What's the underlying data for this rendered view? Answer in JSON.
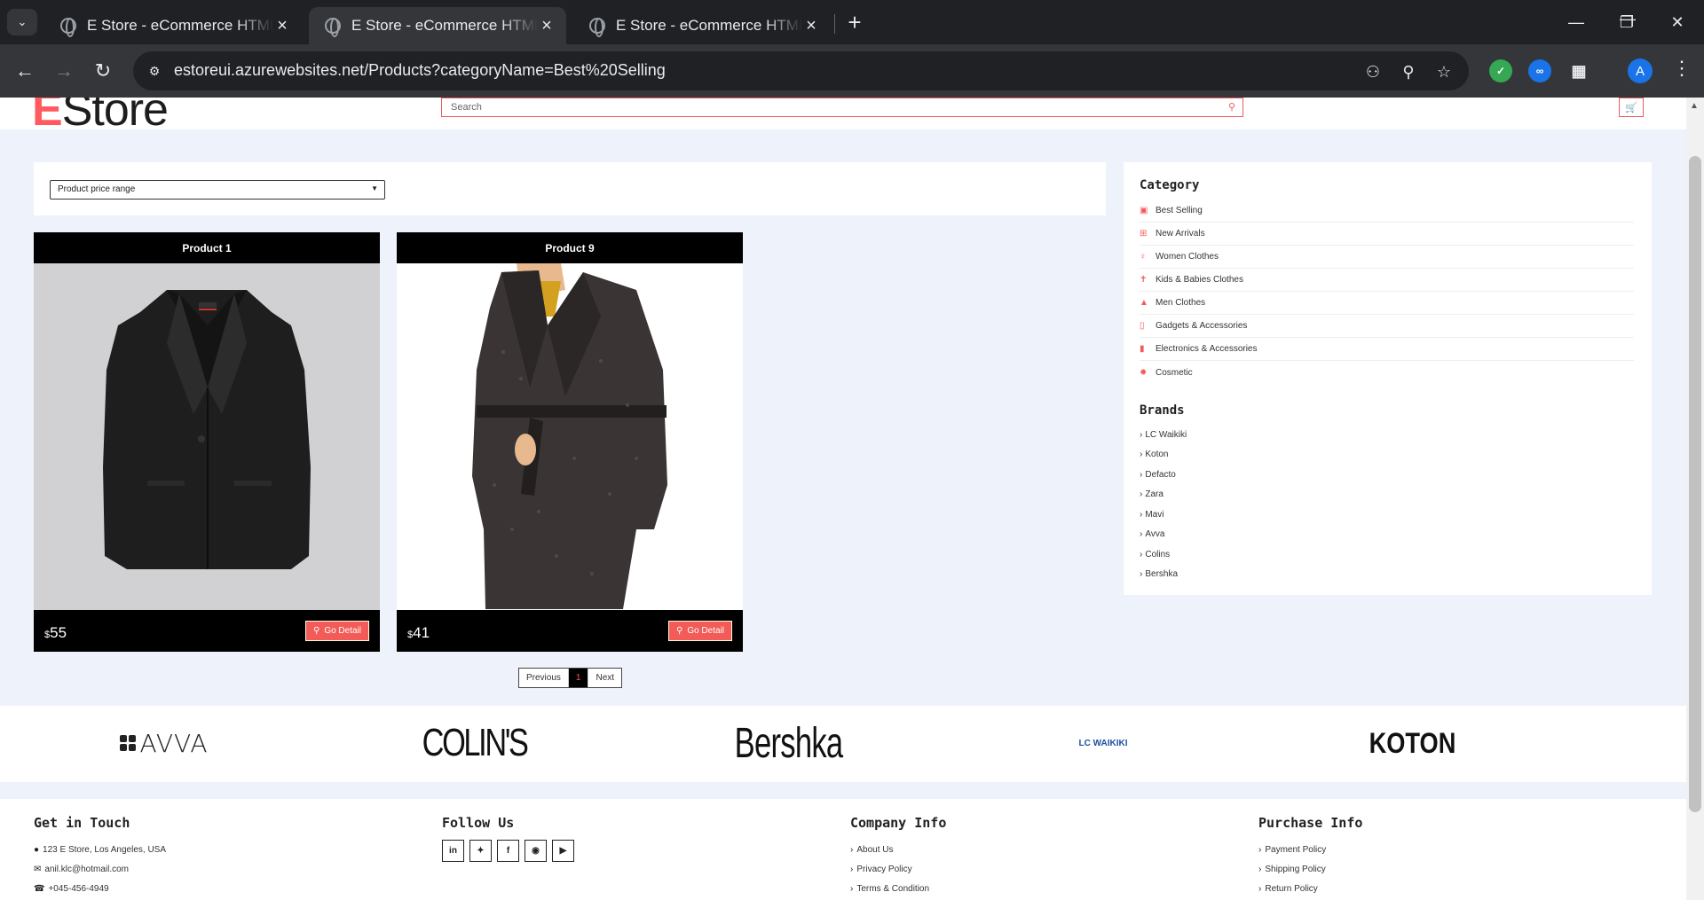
{
  "browser": {
    "tabs": [
      {
        "title": "E Store - eCommerce HTML Template"
      },
      {
        "title": "E Store - eCommerce HTML Template"
      },
      {
        "title": "E Store - eCommerce HTML Template"
      }
    ],
    "url": "estoreui.azurewebsites.net/Products?categoryName=Best%20Selling",
    "profile_initial": "A"
  },
  "header": {
    "logo_first": "E",
    "logo_rest": "Store",
    "search_placeholder": "Search"
  },
  "filter": {
    "price_range_label": "Product price range"
  },
  "products": [
    {
      "title": "Product 1",
      "currency": "$",
      "price": "55",
      "button": "Go Detail"
    },
    {
      "title": "Product 9",
      "currency": "$",
      "price": "41",
      "button": "Go Detail"
    }
  ],
  "pagination": {
    "previous": "Previous",
    "current": "1",
    "next": "Next"
  },
  "sidebar": {
    "category_heading": "Category",
    "categories": [
      {
        "label": "Best Selling",
        "icon": "shopping-bag-icon"
      },
      {
        "label": "New Arrivals",
        "icon": "plus-square-icon"
      },
      {
        "label": "Women Clothes",
        "icon": "female-icon"
      },
      {
        "label": "Kids & Babies Clothes",
        "icon": "child-icon"
      },
      {
        "label": "Men Clothes",
        "icon": "tshirt-icon"
      },
      {
        "label": "Gadgets & Accessories",
        "icon": "mobile-icon"
      },
      {
        "label": "Electronics & Accessories",
        "icon": "microchip-icon"
      },
      {
        "label": "Cosmetic",
        "icon": "sun-icon"
      }
    ],
    "brands_heading": "Brands",
    "brands": [
      "LC Waikiki",
      "Koton",
      "Defacto",
      "Zara",
      "Mavi",
      "Avva",
      "Colins",
      "Bershka"
    ]
  },
  "brand_strip": [
    "AVVA",
    "COLIN'S",
    "Bershka",
    "LC WAIKIKI",
    "KOTON"
  ],
  "footer": {
    "get_in_touch": {
      "heading": "Get in Touch",
      "address": "123 E Store, Los Angeles, USA",
      "email": "anil.klc@hotmail.com",
      "phone": "+045-456-4949"
    },
    "follow_us": {
      "heading": "Follow Us"
    },
    "company_info": {
      "heading": "Company Info",
      "links": [
        "About Us",
        "Privacy Policy",
        "Terms & Condition"
      ]
    },
    "purchase_info": {
      "heading": "Purchase Info",
      "links": [
        "Payment Policy",
        "Shipping Policy",
        "Return Policy"
      ]
    }
  },
  "colors": {
    "accent": "#f25b57",
    "page_bg": "#eef2fb",
    "chrome_dark": "#202124"
  }
}
